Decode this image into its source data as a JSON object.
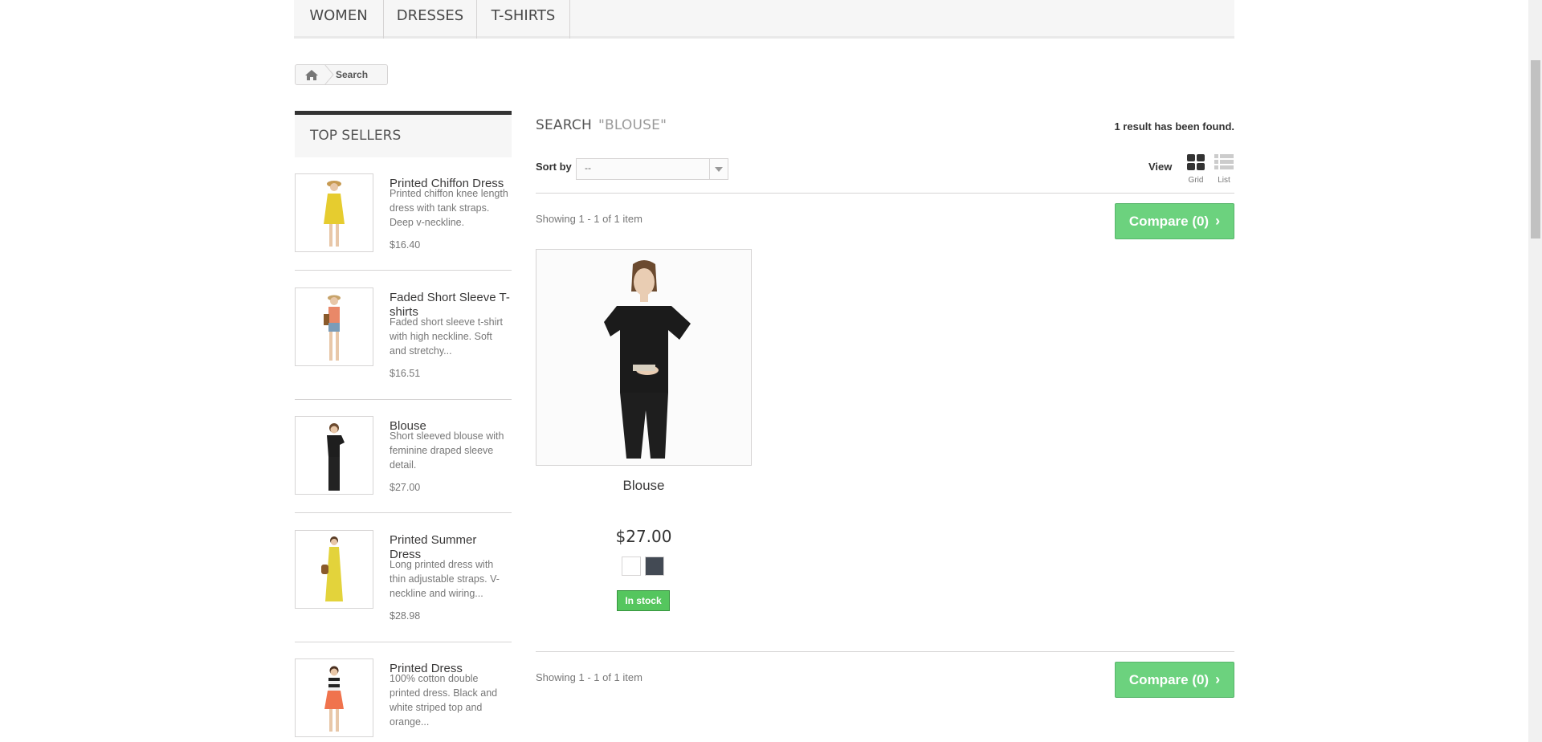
{
  "menu": {
    "items": [
      "WOMEN",
      "DRESSES",
      "T-SHIRTS"
    ]
  },
  "breadcrumb": {
    "current": "Search"
  },
  "sidebar": {
    "title": "TOP SELLERS",
    "items": [
      {
        "name": "Printed Chiffon Dress",
        "desc": "Printed chiffon knee length dress with tank straps. Deep v-neckline.",
        "price": "$16.40",
        "dress_color": "#e6cc2f"
      },
      {
        "name": "Faded Short Sleeve T-shirts",
        "desc": "Faded short sleeve t-shirt with high neckline. Soft and stretchy...",
        "price": "$16.51",
        "dress_color": "#e98868"
      },
      {
        "name": "Blouse",
        "desc": "Short sleeved blouse with feminine draped sleeve detail.",
        "price": "$27.00",
        "dress_color": "#1e1e1e"
      },
      {
        "name": "Printed Summer Dress",
        "desc": "Long printed dress with thin adjustable straps. V-neckline and wiring...",
        "price": "$28.98",
        "dress_color": "#e3d33b"
      },
      {
        "name": "Printed Dress",
        "desc": "100% cotton double printed dress. Black and white striped top and orange...",
        "price": "",
        "dress_color": "#f0734d"
      }
    ]
  },
  "search": {
    "heading": "SEARCH",
    "query": "\"BLOUSE\"",
    "result_count": "1 result has been found.",
    "sort_label": "Sort by",
    "sort_value": "--",
    "view_label": "View",
    "view_grid": "Grid",
    "view_list": "List",
    "showing": "Showing 1 - 1 of 1 item",
    "compare": "Compare (0)"
  },
  "product": {
    "name": "Blouse",
    "price": "$27.00",
    "availability": "In stock",
    "swatches": [
      "#ffffff",
      "#434a54"
    ]
  },
  "colors": {
    "compare_green": "#60cf74",
    "stock_green": "#55c65e",
    "border": "#d6d4d4"
  }
}
